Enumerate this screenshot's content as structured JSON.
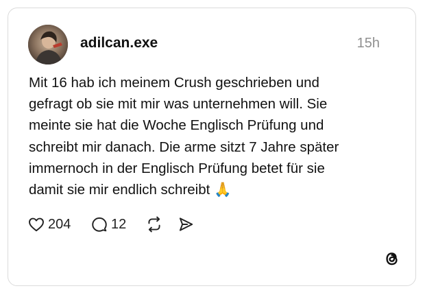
{
  "post": {
    "username": "adilcan.exe",
    "time": "15h",
    "text_lines": [
      "Mit 16 hab ich meinem Crush geschrieben und",
      "gefragt ob sie mit mir was unternehmen will. Sie",
      "meinte sie hat die Woche Englisch Prüfung und",
      "schreibt mir danach. Die arme sitzt 7 Jahre später",
      "immernoch in der Englisch Prüfung betet für sie",
      "damit sie mir endlich schreibt 🙏"
    ],
    "likes": "204",
    "replies": "12"
  },
  "icons": {
    "like": "heart-icon",
    "reply": "comment-bubble-icon",
    "repost": "repost-icon",
    "share": "send-icon",
    "brand": "threads-logo-icon"
  }
}
